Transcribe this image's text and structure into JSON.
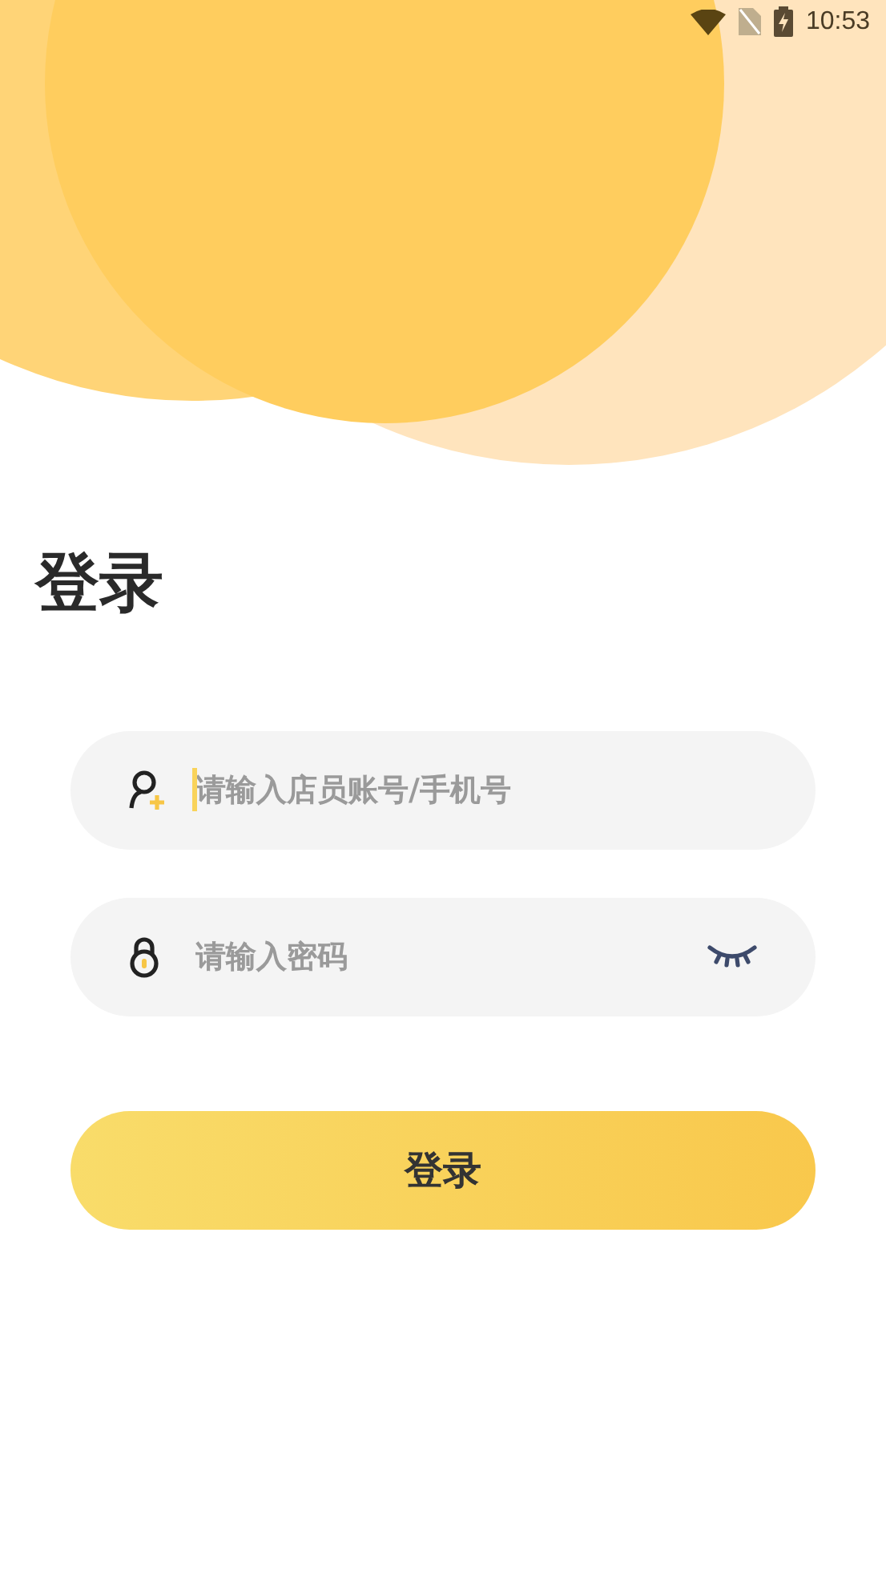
{
  "status_bar": {
    "time": "10:53"
  },
  "title": "登录",
  "fields": [
    {
      "kind": "account",
      "placeholder": "请输入店员账号/手机号",
      "focused": true
    },
    {
      "kind": "password",
      "placeholder": "请输入密码",
      "focused": false
    }
  ],
  "login_button": "登录"
}
